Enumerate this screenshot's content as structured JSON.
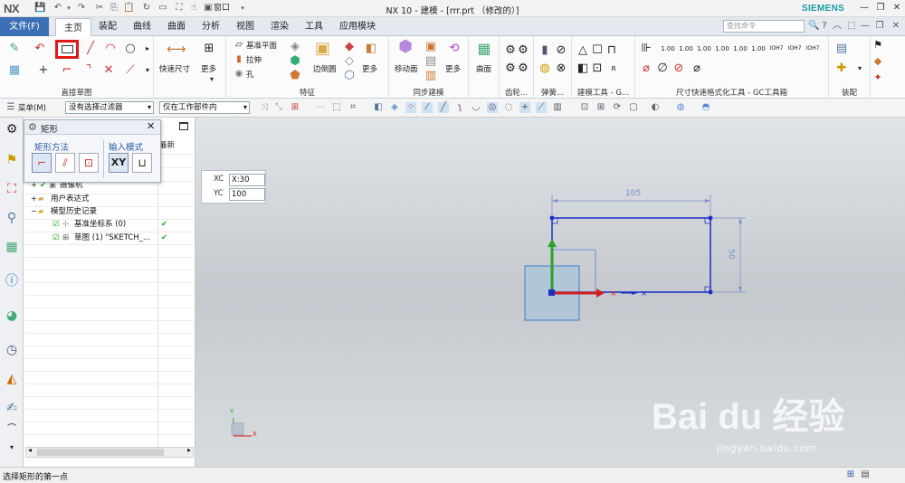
{
  "titlebar": {
    "logo": "NX",
    "window_menu": "窗口",
    "title": "NX 10 - 建模 - [rrr.prt （修改的）]",
    "brand": "SIEMENS"
  },
  "menubar": {
    "file": "文件(F)",
    "tabs": [
      "主页",
      "装配",
      "曲线",
      "曲面",
      "分析",
      "视图",
      "渲染",
      "工具",
      "应用模块"
    ],
    "active_tab": "主页",
    "search_placeholder": "查找命令"
  },
  "ribbon": {
    "groups": {
      "direct_sketch": "直接草图",
      "feature": "特征",
      "sync_modeling": "同步建模",
      "surface": "曲面",
      "trim": "齿轮...",
      "spring": "弹簧...",
      "modeling_tools": "建模工具 - G...",
      "dim_tools": "尺寸快速格式化工具 - GC工具箱",
      "assembly": "装配"
    },
    "buttons": {
      "quick_dim": "快速尺寸",
      "more1": "更多",
      "datum_plane": "基准平面",
      "extrude": "拉伸",
      "hole": "孔",
      "edge_blend": "边倒圆",
      "more2": "更多",
      "move_face": "移动面",
      "more3": "更多",
      "surface": "曲面"
    }
  },
  "toolbar2": {
    "menu": "菜单(M)",
    "filter": "没有选择过滤器",
    "scope": "仅在工作部件内"
  },
  "dialog": {
    "title": "矩形",
    "method_label": "矩形方法",
    "input_label": "输入模式",
    "xy": "XY"
  },
  "navigator": {
    "column_latest": "最新",
    "rows": [
      {
        "label": "摄像机",
        "check": ""
      },
      {
        "label": "用户表达式",
        "check": ""
      },
      {
        "label": "模型历史记录",
        "check": ""
      },
      {
        "label": "基准坐标系 (0)",
        "check": "✔"
      },
      {
        "label": "草图 (1) \"SKETCH_...",
        "check": "✔"
      }
    ]
  },
  "coords": {
    "xc_label": "XC",
    "xc_value": "X:30",
    "yc_label": "YC",
    "yc_value": "100"
  },
  "sketch": {
    "dim_width": "105",
    "dim_height": "50"
  },
  "triad": {
    "y": "Y",
    "x": "X"
  },
  "status": {
    "text": "选择矩形的第一点"
  },
  "watermark": {
    "main": "Bai du 经验",
    "sub": "jingyan.baidu.com"
  }
}
